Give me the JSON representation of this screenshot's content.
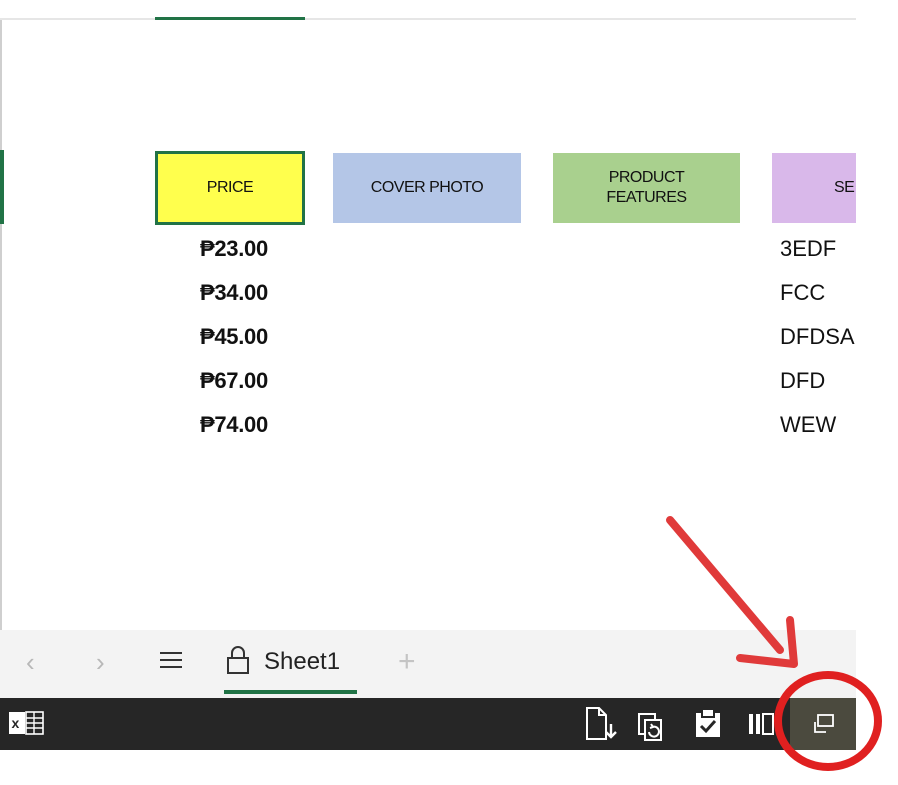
{
  "sheet": {
    "headers": {
      "price": "PRICE",
      "cover_photo": "COVER PHOTO",
      "product_features_line1": "PRODUCT",
      "product_features_line2": "FEATURES",
      "se_partial": "SE"
    },
    "prices": [
      "₱23.00",
      "₱34.00",
      "₱45.00",
      "₱67.00",
      "₱74.00"
    ],
    "codes": [
      "3EDF",
      "FCC",
      "DFDSA",
      "DFD",
      "WEW"
    ]
  },
  "tabbar": {
    "prev_glyph": "‹",
    "next_glyph": "›",
    "sheet_tab": "Sheet1",
    "add_glyph": "+"
  },
  "statusbar": {
    "excel_icon_letter": "x"
  },
  "colors": {
    "accent_green": "#217346",
    "price_header_bg": "#ffff4d",
    "cover_header_bg": "#b4c6e7",
    "features_header_bg": "#a9d08e",
    "se_header_bg": "#d9b8ea",
    "annotation_red": "#e03a3a",
    "statusbar_bg": "#262626"
  },
  "icons": [
    "hamburger-icon",
    "lock-icon",
    "excel-icon",
    "export-file-icon",
    "refresh-file-icon",
    "clipboard-check-icon",
    "page-view-icon",
    "restore-window-icon"
  ]
}
